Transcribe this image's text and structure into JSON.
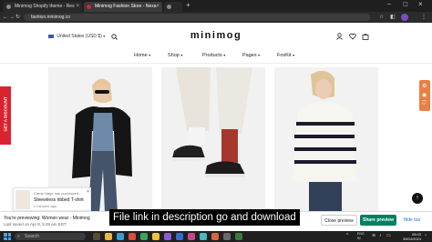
{
  "browser": {
    "tabs": [
      {
        "title": "Minimog Shopify theme - Res"
      },
      {
        "title": "Minimog Fashion Store - Nexa"
      },
      {
        "title": ""
      }
    ],
    "url": "fashion.minimog.co"
  },
  "header": {
    "currency": "United States (USD $)",
    "logo": "minimog",
    "nav": [
      {
        "label": "Home"
      },
      {
        "label": "Shop"
      },
      {
        "label": "Products"
      },
      {
        "label": "Pages"
      },
      {
        "label": "FoxKit"
      }
    ]
  },
  "discount_tab": {
    "label": "GET A DISCOUNT"
  },
  "toast": {
    "line1": "Carrie Nage has purchased",
    "product": "Sleeveless ribbed T-shirt",
    "time": "2 minutes ago"
  },
  "preview": {
    "line1": "You're previewing: Women wear - Minimog",
    "line2": "Last saved on Apr 8, 5:49 am EDT",
    "close_label": "Close preview",
    "share_label": "Share preview",
    "hide_label": "Hide bar"
  },
  "caption": "File link in description go and download",
  "taskbar": {
    "search_placeholder": "Search",
    "language": "ENG\nIN",
    "time": "08:03",
    "date": "30/04/2024"
  },
  "colors": {
    "accent_red": "#d9232e",
    "accent_orange": "#e87f45",
    "share_green": "#008060"
  }
}
